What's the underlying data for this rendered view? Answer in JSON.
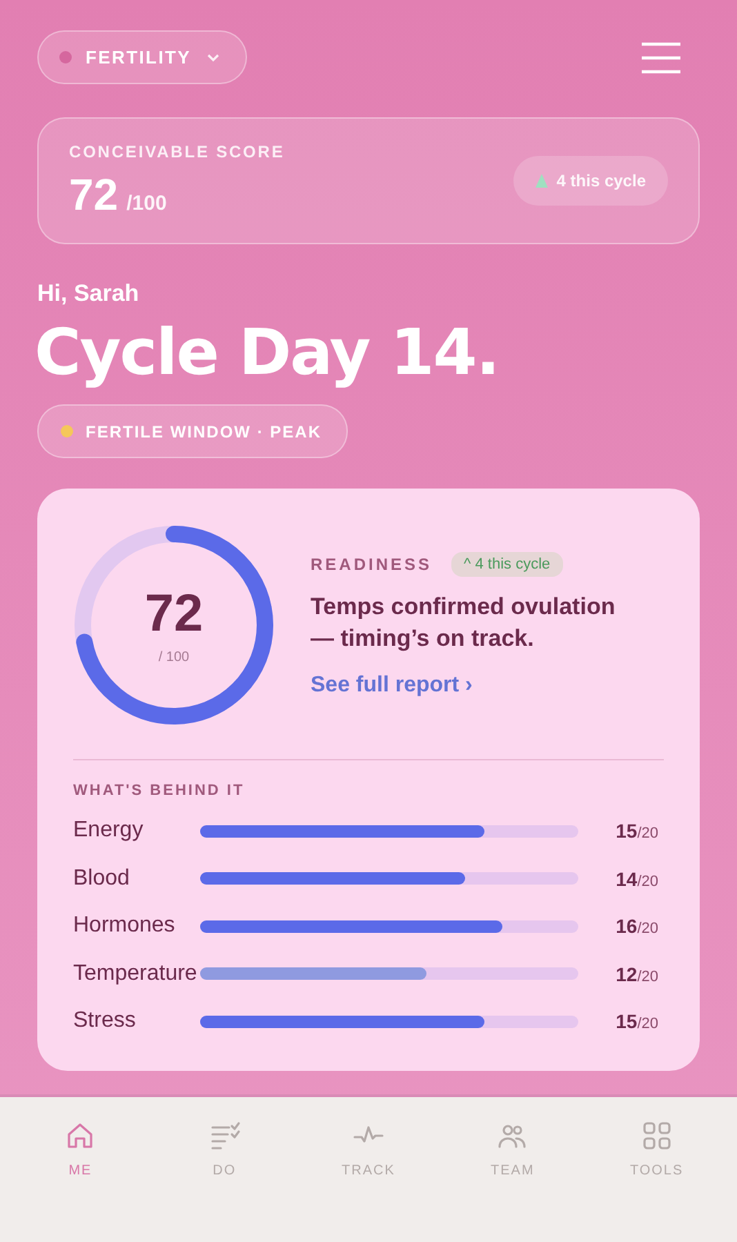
{
  "mode_selector": {
    "label": "FERTILITY"
  },
  "score_card": {
    "label": "CONCEIVABLE SCORE",
    "score": "72",
    "out_of": "/100",
    "change": "4 this cycle"
  },
  "greeting": "Hi, Sarah",
  "title": "Cycle Day 14.",
  "phase_pill": {
    "label": "FERTILE WINDOW · PEAK"
  },
  "readiness": {
    "score": "72",
    "out_of": "/ 100",
    "label": "READINESS",
    "badge": "^ 4 this cycle",
    "message": "Temps confirmed ovulation — timing’s on track.",
    "link": "See full report ›",
    "factors_heading": "WHAT'S BEHIND IT",
    "factors": [
      {
        "name": "Energy",
        "level": 0.75,
        "value": "15",
        "max": "/20",
        "color": "#5b6ae8"
      },
      {
        "name": "Blood",
        "level": 0.7,
        "value": "14",
        "max": "/20",
        "color": "#5b6ae8"
      },
      {
        "name": "Hormones",
        "level": 0.8,
        "value": "16",
        "max": "/20",
        "color": "#5b6ae8"
      },
      {
        "name": "Temperature",
        "level": 0.6,
        "value": "12",
        "max": "/20",
        "color": "#8f9ae0"
      },
      {
        "name": "Stress",
        "level": 0.75,
        "value": "15",
        "max": "/20",
        "color": "#5b6ae8"
      }
    ]
  },
  "nav": [
    {
      "kind": "home",
      "label": "ME",
      "selected": true
    },
    {
      "kind": "tasks",
      "label": "DO",
      "selected": false
    },
    {
      "kind": "pulse",
      "label": "TRACK",
      "selected": false
    },
    {
      "kind": "people",
      "label": "TEAM",
      "selected": false
    },
    {
      "kind": "grid",
      "label": "TOOLS",
      "selected": false
    }
  ]
}
